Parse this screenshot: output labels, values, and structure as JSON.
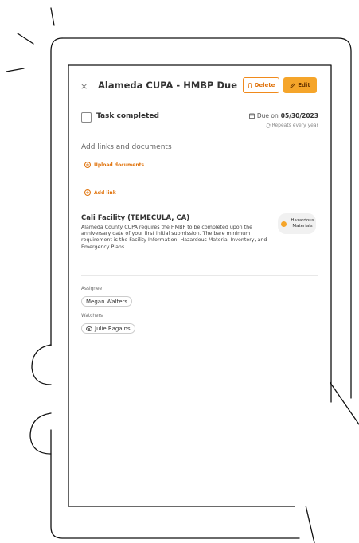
{
  "task": {
    "title": "Alameda CUPA - HMBP Due",
    "close_glyph": "×",
    "delete_label": "Delete",
    "edit_label": "Edit",
    "completed_label": "Task completed",
    "due_prefix": "Due on",
    "due_date": "05/30/2023",
    "repeats": "Repeats every year"
  },
  "links": {
    "heading": "Add links and documents",
    "upload_label": "Upload documents",
    "add_link_label": "Add link"
  },
  "facility": {
    "name": "Cali Facility (TEMECULA, CA)",
    "description": "Alameda County CUPA requires the HMBP to be completed upon the anniversary date of your first initial submission. The bare minimum requirement is the Facility Information, Hazardous Material Inventory, and Emergency Plans.",
    "badge_label": "Hazardous Materials"
  },
  "people": {
    "assignee_label": "Assignee",
    "assignee": "Megan Walters",
    "watchers_label": "Watchers",
    "watchers": [
      "Julie Ragains"
    ]
  },
  "colors": {
    "accent": "#f08a1c",
    "edit_button": "#f5a52a"
  },
  "icons": {
    "close": "close-icon",
    "delete": "trash-icon",
    "edit": "pencil-icon",
    "due": "calendar-icon",
    "repeat": "repeat-icon",
    "add": "plus-circle-icon",
    "badge": "hazard-icon",
    "watcher": "eye-icon"
  }
}
